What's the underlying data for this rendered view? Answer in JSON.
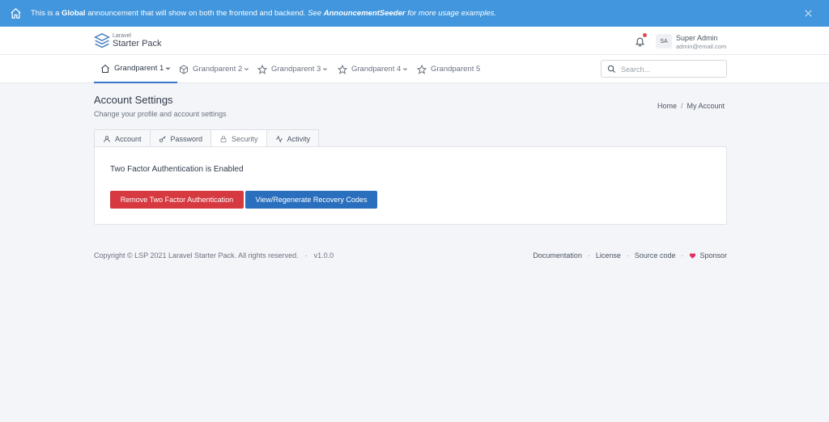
{
  "banner": {
    "prefix": "This is a ",
    "bold": "Global",
    "middle": " announcement that will show on both the frontend and backend. ",
    "italic_prefix": "See ",
    "italic_bold": "AnnouncementSeeder",
    "italic_suffix": " for more usage examples.",
    "color": "#4196dd"
  },
  "header": {
    "logo_small": "Laravel",
    "logo_big": "Starter Pack",
    "avatar_initials": "SA",
    "user_name": "Super Admin",
    "user_email": "admin@email.com"
  },
  "nav": {
    "items": [
      {
        "label": "Grandparent 1"
      },
      {
        "label": "Grandparent 2"
      },
      {
        "label": "Grandparent 3"
      },
      {
        "label": "Grandparent 4"
      },
      {
        "label": "Grandparent 5"
      }
    ],
    "search_placeholder": "Search..."
  },
  "page": {
    "title": "Account Settings",
    "subtitle": "Change your profile and account settings",
    "breadcrumb": [
      "Home",
      "My Account"
    ]
  },
  "tabs": [
    {
      "label": "Account"
    },
    {
      "label": "Password"
    },
    {
      "label": "Security"
    },
    {
      "label": "Activity"
    }
  ],
  "card": {
    "status_text": "Two Factor Authentication is Enabled",
    "remove_button": "Remove Two Factor Authentication",
    "recovery_button": "View/Regenerate Recovery Codes"
  },
  "footer": {
    "copyright": "Copyright © LSP 2021 Laravel Starter Pack. All rights reserved.",
    "version": "v1.0.0",
    "links": [
      "Documentation",
      "License",
      "Source code",
      "Sponsor"
    ]
  }
}
